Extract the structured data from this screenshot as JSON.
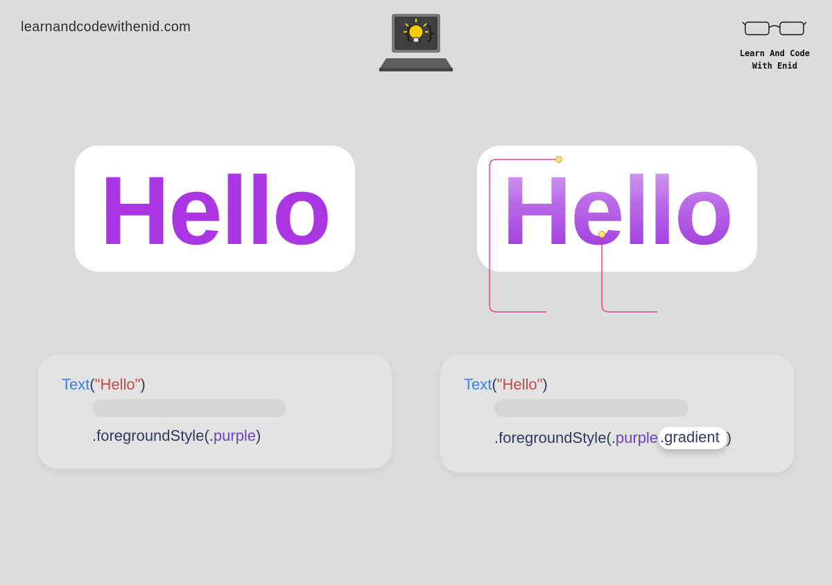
{
  "url": "learnandcodewithenid.com",
  "brand": {
    "line1": "Learn And Code",
    "line2": "With Enid"
  },
  "preview": {
    "text": "Hello"
  },
  "codeLeft": {
    "text_kw": "Text",
    "open_paren": "(",
    "quote_open": "\"",
    "string": "Hello",
    "quote_close": "\"",
    "close_paren": ")",
    "method": ".foregroundStyle",
    "arg_open": "(",
    "dot": ".",
    "color_kw": "purple",
    "arg_close": ")"
  },
  "codeRight": {
    "text_kw": "Text",
    "open_paren": "(",
    "quote_open": "\"",
    "string": "Hello",
    "quote_close": "\"",
    "close_paren": ")",
    "method": ".foregroundStyle",
    "arg_open": "(",
    "dot": ".",
    "color_kw": "purple",
    "dot2": ".",
    "grad_kw": "gradient",
    "arg_close": ")"
  }
}
